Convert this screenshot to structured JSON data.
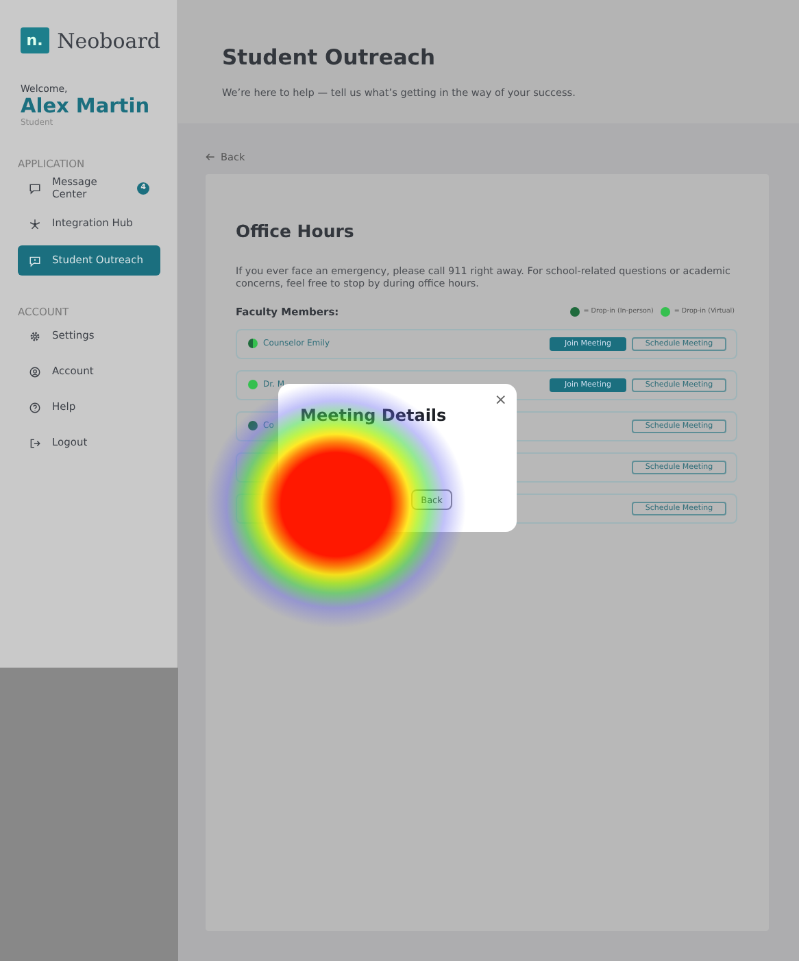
{
  "brand": {
    "mark": "n.",
    "name": "Neoboard"
  },
  "user": {
    "greeting": "Welcome,",
    "name": "Alex Martin",
    "role": "Student"
  },
  "sidebar": {
    "sections": [
      {
        "title": "APPLICATION",
        "items": [
          {
            "label": "Message Center",
            "kind": "message",
            "badge": "4",
            "selected": false
          },
          {
            "label": "Integration Hub",
            "kind": "hub",
            "selected": false
          },
          {
            "label": "Student Outreach",
            "kind": "outreach",
            "selected": true
          }
        ]
      },
      {
        "title": "ACCOUNT",
        "items": [
          {
            "label": "Settings",
            "kind": "settings",
            "selected": false
          },
          {
            "label": "Account",
            "kind": "account",
            "selected": false
          },
          {
            "label": "Help",
            "kind": "help",
            "selected": false
          },
          {
            "label": "Logout",
            "kind": "logout",
            "selected": false
          }
        ]
      }
    ]
  },
  "header": {
    "title": "Student Outreach",
    "subtitle": "We’re here to help — tell us what’s getting in the way of your success."
  },
  "back": "Back",
  "office_hours": {
    "title": "Office Hours",
    "intro": "If you ever face an emergency, please call 911 right away. For school-related questions or academic concerns, feel free to stop by during office hours.",
    "faculty_label": "Faculty Members:",
    "legend": [
      {
        "label": "= Drop-in (In-person)",
        "color": "#1f6a3c"
      },
      {
        "label": "= Drop-in (Virtual)",
        "color": "#35c04f"
      }
    ],
    "faculty": [
      {
        "name": "Counselor Emily",
        "in_person": true,
        "virtual": true,
        "join": "Join Meeting",
        "schedule": "Schedule Meeting"
      },
      {
        "name": "Dr. M",
        "in_person": false,
        "virtual": true,
        "join": "Join Meeting",
        "schedule": "Schedule Meeting"
      },
      {
        "name": "Co",
        "in_person": true,
        "virtual": false,
        "schedule": "Schedule Meeting"
      },
      {
        "schedule": "Schedule Meeting"
      },
      {
        "schedule": "Schedule Meeting"
      }
    ]
  },
  "modal": {
    "title": "Meeting Details",
    "close": "×",
    "button": "Back"
  }
}
